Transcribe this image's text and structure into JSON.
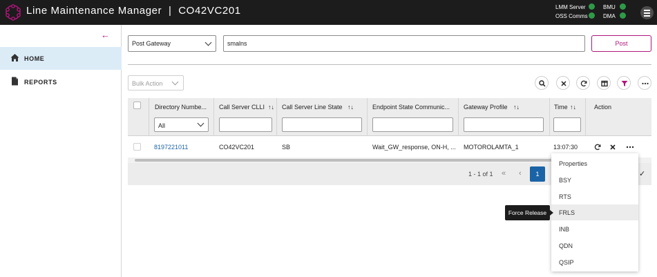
{
  "header": {
    "app_name": "Line Maintenance Manager",
    "separator": "|",
    "device_id": "CO42VC201",
    "status": [
      {
        "label": "LMM Server",
        "color": "#2e9a48"
      },
      {
        "label": "BMU",
        "color": "#2e9a48"
      },
      {
        "label": "OSS Comms",
        "color": "#2e9a48"
      },
      {
        "label": "DMA",
        "color": "#2e9a48"
      }
    ]
  },
  "sidebar": {
    "items": [
      {
        "label": "HOME",
        "icon": "home-icon",
        "active": true
      },
      {
        "label": "REPORTS",
        "icon": "document-icon",
        "active": false
      }
    ]
  },
  "post_bar": {
    "gateway_select": "Post Gateway",
    "search_value": "smalns",
    "post_button": "Post"
  },
  "toolbar": {
    "bulk_action": "Bulk Action",
    "icons": [
      "search-icon",
      "clear-icon",
      "refresh-icon",
      "columns-icon",
      "filter-icon",
      "more-icon"
    ]
  },
  "table": {
    "columns": [
      {
        "label": "Directory Numbe...",
        "sortable": false
      },
      {
        "label": "Call Server CLLI",
        "sortable": true
      },
      {
        "label": "Call Server Line State",
        "sortable": true
      },
      {
        "label": "Endpoint State Communic...",
        "sortable": false
      },
      {
        "label": "Gateway Profile",
        "sortable": true
      },
      {
        "label": "Time",
        "sortable": true
      },
      {
        "label": "Action",
        "sortable": false
      }
    ],
    "sort_glyph": "↑↓",
    "directory_filter": "All",
    "rows": [
      {
        "directory_number": "8197221011",
        "clli": "CO42VC201",
        "line_state": "SB",
        "endpoint_state": "Wait_GW_response, ON-H, ...",
        "gateway_profile": "MOTOROLAMTA_1",
        "time": "13:07:30"
      }
    ],
    "pagination": {
      "info": "1 - 1 of 1",
      "first": "«",
      "prev": "‹",
      "current_page": "1",
      "check": "✓"
    }
  },
  "action_menu": {
    "items": [
      "Properties",
      "BSY",
      "RTS",
      "FRLS",
      "INB",
      "QDN",
      "QSIP"
    ],
    "hovered": "FRLS",
    "tooltip": "Force Release"
  },
  "colors": {
    "accent": "#b0157b",
    "link": "#1a63a6",
    "header_bg": "#1c1c1c",
    "status_ok": "#2e9a48"
  }
}
